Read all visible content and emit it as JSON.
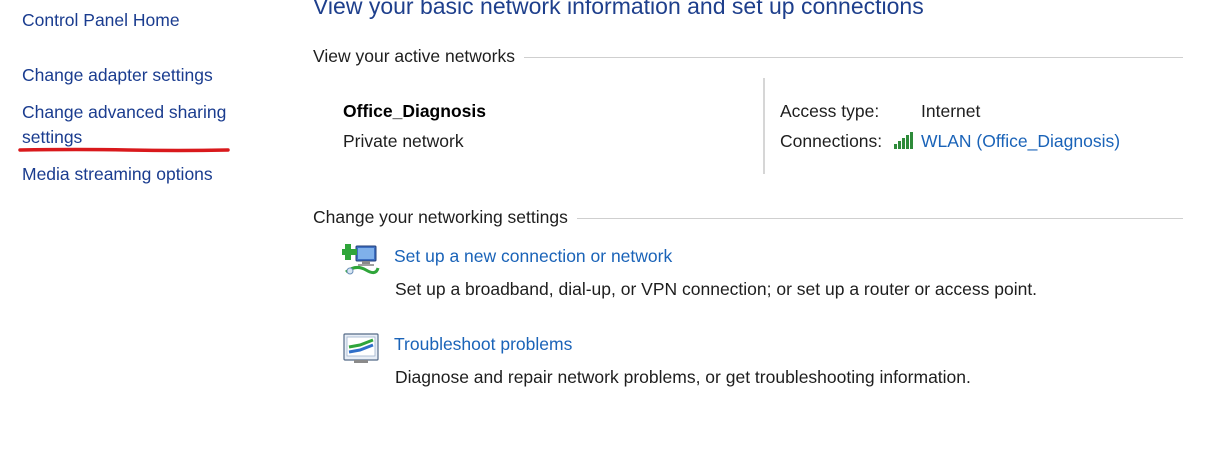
{
  "sidebar": {
    "home": "Control Panel Home",
    "adapter": "Change adapter settings",
    "sharing": "Change advanced sharing settings",
    "media": "Media streaming options"
  },
  "main": {
    "title": "View your basic network information and set up connections",
    "active_networks_header": "View your active networks",
    "network": {
      "name": "Office_Diagnosis",
      "type": "Private network",
      "access_type_label": "Access type:",
      "access_type_value": "Internet",
      "connections_label": "Connections:",
      "connections_value": "WLAN (Office_Diagnosis)"
    },
    "settings_header": "Change your networking settings",
    "tasks": [
      {
        "label": "Set up a new connection or network",
        "description": "Set up a broadband, dial-up, or VPN connection; or set up a router or access point.",
        "icon": "new-connection-icon"
      },
      {
        "label": "Troubleshoot problems",
        "description": "Diagnose and repair network problems, or get troubleshooting information.",
        "icon": "troubleshoot-icon"
      }
    ]
  },
  "colors": {
    "link": "#1a63b8",
    "nav_link": "#1a3c8f",
    "title": "#1e3f8c",
    "annotation_red": "#d9191c",
    "signal_green": "#2e8b3a"
  }
}
